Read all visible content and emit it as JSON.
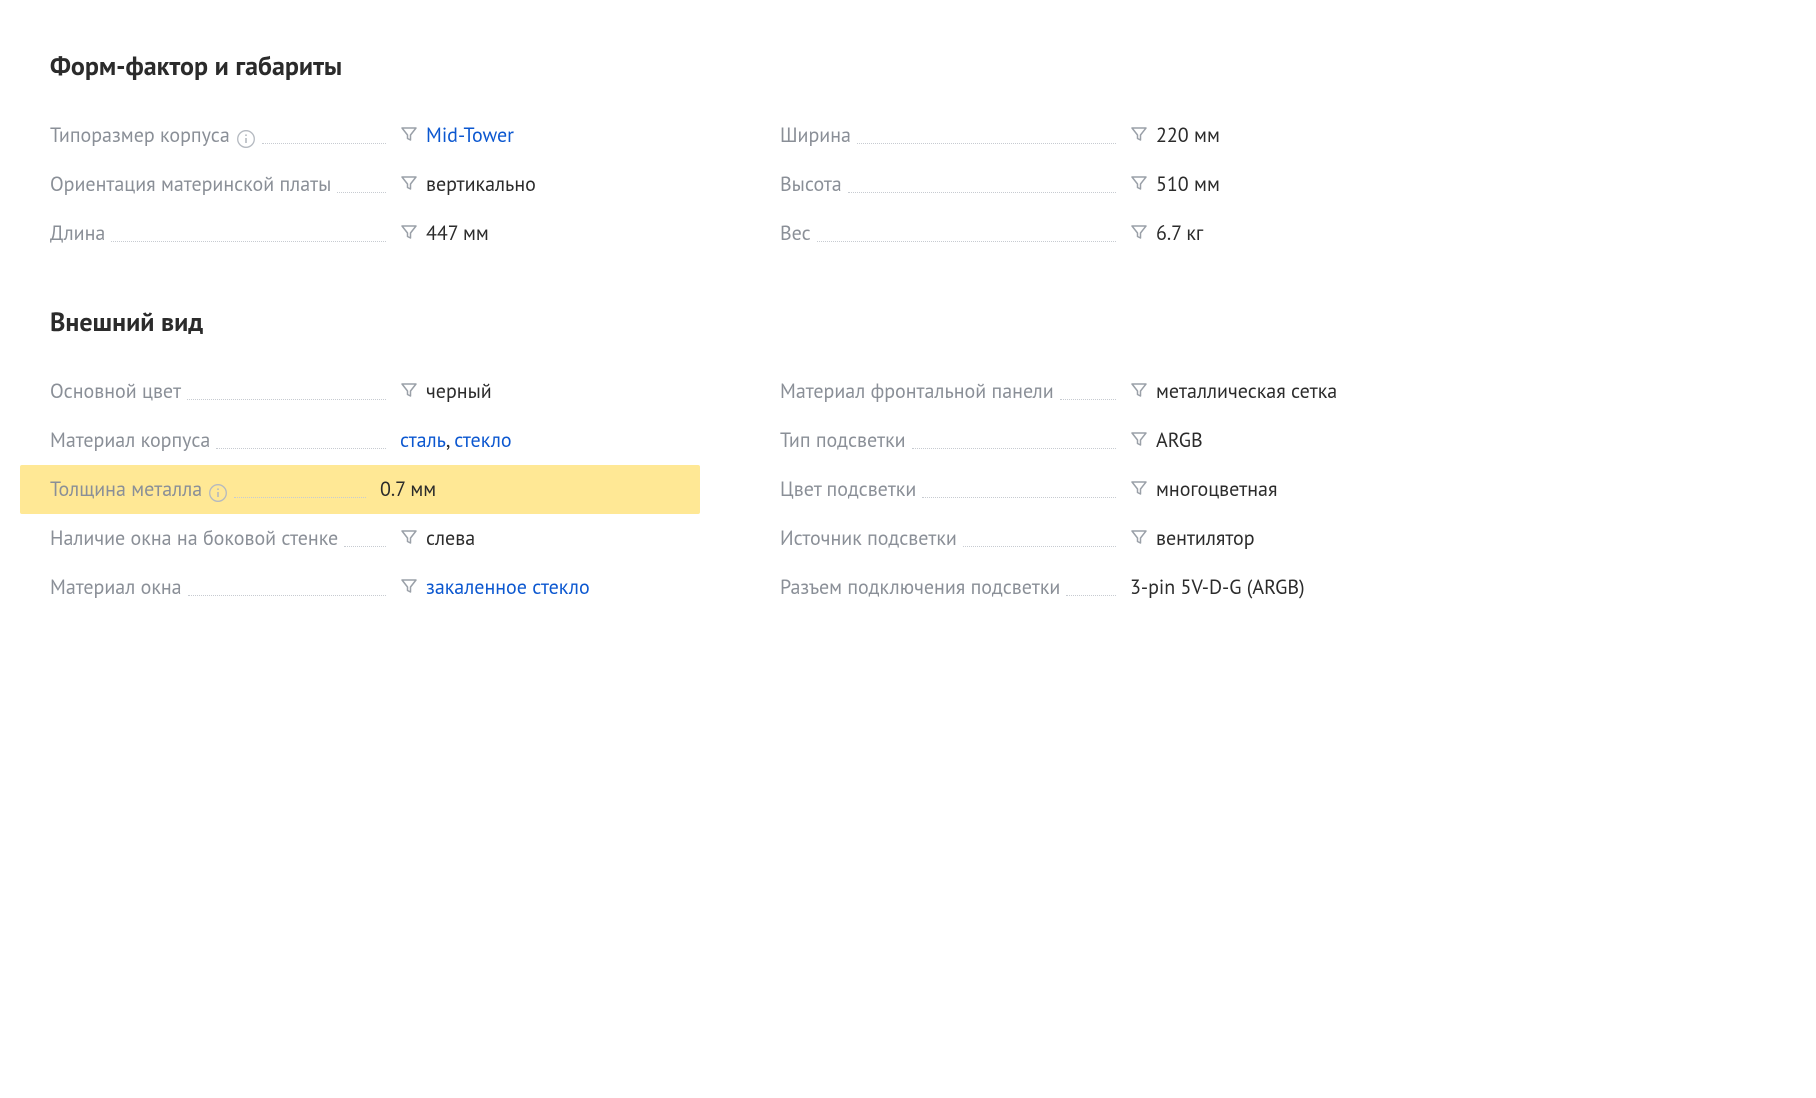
{
  "sections": {
    "form_factor": {
      "title": "Форм-фактор и габариты",
      "left": [
        {
          "label": "Типоразмер корпуса",
          "info": true,
          "filter": true,
          "value": "Mid-Tower",
          "link": true
        },
        {
          "label": "Ориентация материнской платы",
          "info": false,
          "filter": true,
          "value": "вертикально",
          "link": false
        },
        {
          "label": "Длина",
          "info": false,
          "filter": true,
          "value": "447 мм",
          "link": false
        }
      ],
      "right": [
        {
          "label": "Ширина",
          "info": false,
          "filter": true,
          "value": "220 мм",
          "link": false
        },
        {
          "label": "Высота",
          "info": false,
          "filter": true,
          "value": "510 мм",
          "link": false
        },
        {
          "label": "Вес",
          "info": false,
          "filter": true,
          "value": "6.7 кг",
          "link": false
        }
      ]
    },
    "appearance": {
      "title": "Внешний вид",
      "left": [
        {
          "label": "Основной цвет",
          "info": false,
          "filter": true,
          "value": "черный",
          "link": false
        },
        {
          "label": "Материал корпуса",
          "info": false,
          "filter": false,
          "multi": [
            "сталь",
            "стекло"
          ],
          "link": true
        },
        {
          "label": "Толщина металла",
          "info": true,
          "filter": false,
          "value": "0.7 мм",
          "link": false,
          "highlighted": true
        },
        {
          "label": "Наличие окна на боковой стенке",
          "info": false,
          "filter": true,
          "value": "слева",
          "link": false
        },
        {
          "label": "Материал окна",
          "info": false,
          "filter": true,
          "value": "закаленное стекло",
          "link": true
        }
      ],
      "right": [
        {
          "label": "Материал фронтальной панели",
          "info": false,
          "filter": true,
          "value": "металлическая сетка",
          "link": false
        },
        {
          "label": "Тип подсветки",
          "info": false,
          "filter": true,
          "value": "ARGB",
          "link": false
        },
        {
          "label": "Цвет подсветки",
          "info": false,
          "filter": true,
          "value": "многоцветная",
          "link": false
        },
        {
          "label": "Источник подсветки",
          "info": false,
          "filter": true,
          "value": "вентилятор",
          "link": false
        },
        {
          "label": "Разъем подключения подсветки",
          "info": false,
          "filter": false,
          "value": "3-pin 5V-D-G (ARGB)",
          "link": false
        }
      ]
    }
  }
}
